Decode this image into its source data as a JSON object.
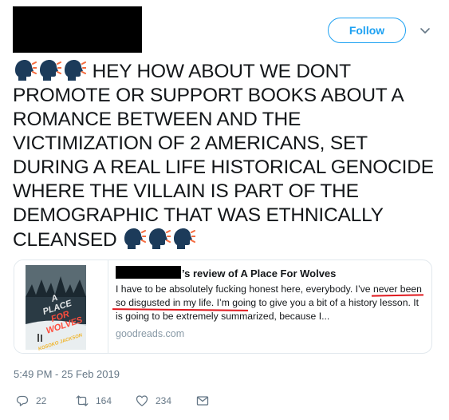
{
  "header": {
    "follow_label": "Follow"
  },
  "tweet": {
    "text_line1": "HEY HOW ABOUT WE DONT",
    "text_rest": "PROMOTE OR SUPPORT BOOKS ABOUT A ROMANCE BETWEEN AND THE VICTIMIZATION OF 2 AMERICANS, SET DURING A REAL LIFE HISTORICAL GENOCIDE WHERE THE VILLAIN IS PART OF THE DEMOGRAPHIC THAT WAS ETHNICALLY",
    "text_last": "CLEANSED",
    "emoji_icon": "speaking-head-emoji",
    "timestamp": "5:49 PM - 25 Feb 2019"
  },
  "card": {
    "title_suffix": "’s review of A Place For Wolves",
    "description": "I have to be absolutely fucking honest here, everybody. I’ve never been so disgusted in my life. I’m going to give you a bit of a history lesson. It is going to be extremely summarized, because I...",
    "domain": "goodreads.com",
    "book_cover_text": [
      "A",
      "PLACE",
      "FOR",
      "WOLVES",
      "KOSOKO JACKSON"
    ]
  },
  "actions": {
    "reply_count": "22",
    "retweet_count": "164",
    "like_count": "234"
  },
  "colors": {
    "accent": "#1da1f2",
    "muted": "#657786",
    "underline": "#e0181e"
  }
}
